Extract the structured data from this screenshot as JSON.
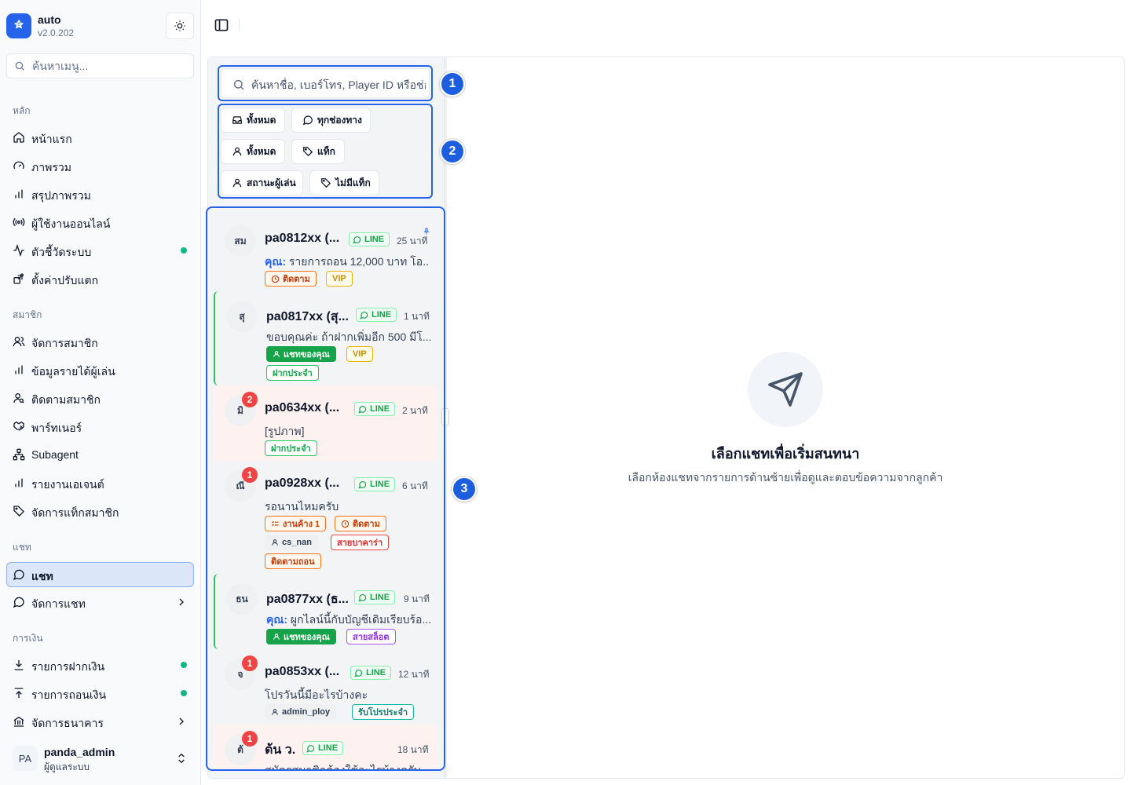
{
  "app": {
    "name": "auto",
    "version": "v2.0.202"
  },
  "sidebar": {
    "search_placeholder": "ค้นหาเมนู...",
    "sections": [
      {
        "title": "หลัก",
        "items": [
          {
            "label": "หน้าแรก",
            "icon": "home-icon"
          },
          {
            "label": "ภาพรวม",
            "icon": "gauge-icon"
          },
          {
            "label": "สรุปภาพรวม",
            "icon": "bar-chart-icon"
          },
          {
            "label": "ผู้ใช้งานออนไลน์",
            "icon": "radio-icon",
            "status": "none"
          },
          {
            "label": "ตัวชี้วัดระบบ",
            "icon": "activity-icon",
            "status": "online"
          },
          {
            "label": "ตั้งค่าปรับแตก",
            "icon": "settings-share-icon"
          }
        ]
      },
      {
        "title": "สมาชิก",
        "items": [
          {
            "label": "จัดการสมาชิก",
            "icon": "users-icon"
          },
          {
            "label": "ข้อมูลรายได้ผู้เล่น",
            "icon": "bar-chart-icon"
          },
          {
            "label": "ติดตามสมาชิก",
            "icon": "user-search-icon"
          },
          {
            "label": "พาร์ทเนอร์",
            "icon": "handshake-icon"
          },
          {
            "label": "Subagent",
            "icon": "network-icon"
          },
          {
            "label": "รายงานเอเจนต์",
            "icon": "bar-chart-icon"
          },
          {
            "label": "จัดการแท็กสมาชิก",
            "icon": "tag-icon"
          }
        ]
      },
      {
        "title": "แชท",
        "items": [
          {
            "label": "แชท",
            "icon": "message-circle-icon",
            "active": true
          },
          {
            "label": "จัดการแชท",
            "icon": "message-circle-icon",
            "expandable": true
          }
        ]
      },
      {
        "title": "การเงิน",
        "items": [
          {
            "label": "รายการฝากเงิน",
            "icon": "download-icon",
            "status": "online"
          },
          {
            "label": "รายการถอนเงิน",
            "icon": "upload-icon",
            "status": "online"
          },
          {
            "label": "จัดการธนาคาร",
            "icon": "bank-icon",
            "expandable": true
          }
        ]
      }
    ],
    "user": {
      "initials": "PA",
      "name": "panda_admin",
      "role": "ผู้ดูแลระบบ"
    }
  },
  "chat_list": {
    "search_placeholder": "ค้นหาชื่อ, เบอร์โทร, Player ID หรือช่อ",
    "filters": [
      {
        "label": "ทั้งหมด",
        "icon": "inbox-icon"
      },
      {
        "label": "ทุกช่องทาง",
        "icon": "message-circle-icon"
      },
      {
        "label": "ทั้งหมด",
        "icon": "user-icon"
      },
      {
        "label": "แท็ก",
        "icon": "tag-icon"
      },
      {
        "label": "สถานะผู้เล่น",
        "icon": "user-icon"
      },
      {
        "label": "ไม่มีแท็ก",
        "icon": "tag-icon"
      }
    ],
    "channel_label": "LINE",
    "you_prefix": "คุณ:",
    "items": [
      {
        "avatar": "สม",
        "name": "pa0812xx (...",
        "time": "25 นาที",
        "preview": "รายการถอน 12,000 บาท โอ...",
        "from_you": true,
        "pinned": true,
        "tags": [
          "ติดตาม",
          "VIP"
        ]
      },
      {
        "avatar": "สุ",
        "name": "pa0817xx (สุ...",
        "time": "1 นาที",
        "preview": "ขอบคุณค่ะ ถ้าฝากเพิ่มอีก 500 มีโ...",
        "tags": [
          "แชทของคุณ",
          "VIP",
          "ฝากประจำ"
        ]
      },
      {
        "avatar": "มิ",
        "unread": "2",
        "name": "pa0634xx (...",
        "time": "2 นาที",
        "preview": "[รูปภาพ]",
        "tags": [
          "ฝากประจำ"
        ]
      },
      {
        "avatar": "ณี",
        "unread": "1",
        "name": "pa0928xx (...",
        "time": "6 นาที",
        "preview": "รอนานไหมครับ",
        "tags": [
          "งานค้าง 1",
          "ติดตาม",
          "cs_nan",
          "สายบาคาร่า",
          "ติดตามถอน"
        ]
      },
      {
        "avatar": "ธน",
        "name": "pa0877xx (ธ...",
        "time": "9 นาที",
        "preview": "ผูกไลน์นี้กับบัญชีเดิมเรียบร้อ...",
        "from_you": true,
        "tags": [
          "แชทของคุณ",
          "สายสล็อต"
        ]
      },
      {
        "avatar": "จ",
        "unread": "1",
        "name": "pa0853xx (...",
        "time": "12 นาที",
        "preview": "โปรวันนี้มีอะไรบ้างคะ",
        "tags": [
          "admin_ploy",
          "รับโปรประจำ"
        ]
      },
      {
        "avatar": "ต้",
        "unread": "1",
        "name": "ต้น ว.",
        "time": "18 นาที",
        "preview": "สมัครสมาชิกต้องใช้อะไรบ้างครับ",
        "tags": []
      }
    ]
  },
  "callouts": [
    "1",
    "2",
    "3"
  ],
  "empty_state": {
    "title": "เลือกแชทเพื่อเริ่มสนทนา",
    "subtitle": "เลือกห้องแชทจากรายการด้านซ้ายเพื่อดูและตอบข้อความจากลูกค้า"
  },
  "colors": {
    "primary": "#2563eb",
    "online": "#10b981",
    "unread": "#ef4444",
    "line_green": "#16a34a"
  }
}
